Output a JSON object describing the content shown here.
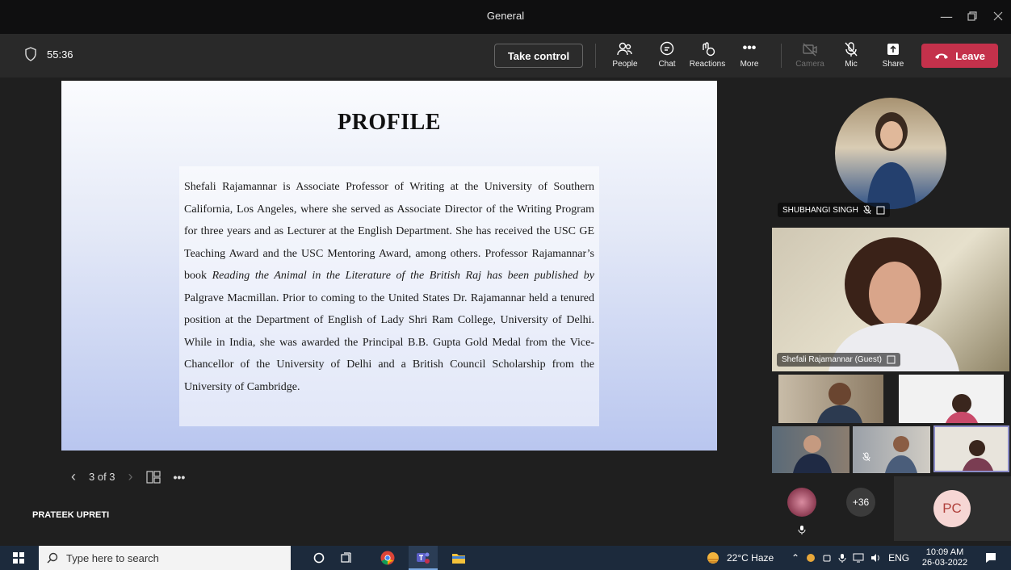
{
  "window": {
    "title": "General"
  },
  "meeting": {
    "timer": "55:36",
    "take_control": "Take control"
  },
  "toolbar": {
    "people": "People",
    "chat": "Chat",
    "reactions": "Reactions",
    "more": "More",
    "camera": "Camera",
    "mic": "Mic",
    "share": "Share",
    "leave": "Leave",
    "leave_color": "#c4314b"
  },
  "slide": {
    "title": "PROFILE",
    "body_before_italic": "Shefali Rajamannar is Associate Professor of Writing at the University of Southern California, Los Angeles, where she served as Associate Director of the Writing Program for three years and as Lecturer at the English Department. She has received the USC GE Teaching Award and the USC Mentoring Award, among others. Professor Rajamannar’s book ",
    "body_italic": "Reading the Animal in the Literature of the British Raj has been published by",
    "body_after_italic": " Palgrave Macmillan. Prior to coming to the United States Dr. Rajamannar held a tenured position at the Department of English of Lady Shri Ram College, University of Delhi. While in India, she was awarded the Principal B.B. Gupta Gold Medal from the Vice-Chancellor of the University of Delhi and a British Council Scholarship from the University of Cambridge."
  },
  "slide_nav": {
    "page": "3 of 3"
  },
  "presenter": {
    "name": "PRATEEK UPRETI"
  },
  "participants": {
    "shubhangi": "SHUBHANGI SINGH",
    "shefali": "Shefali Rajamannar (Guest)",
    "overflow_count": "+36",
    "pc_initials": "PC"
  },
  "taskbar": {
    "search_placeholder": "Type here to search",
    "weather": "22°C  Haze",
    "lang": "ENG",
    "time": "10:09 AM",
    "date": "26-03-2022"
  }
}
